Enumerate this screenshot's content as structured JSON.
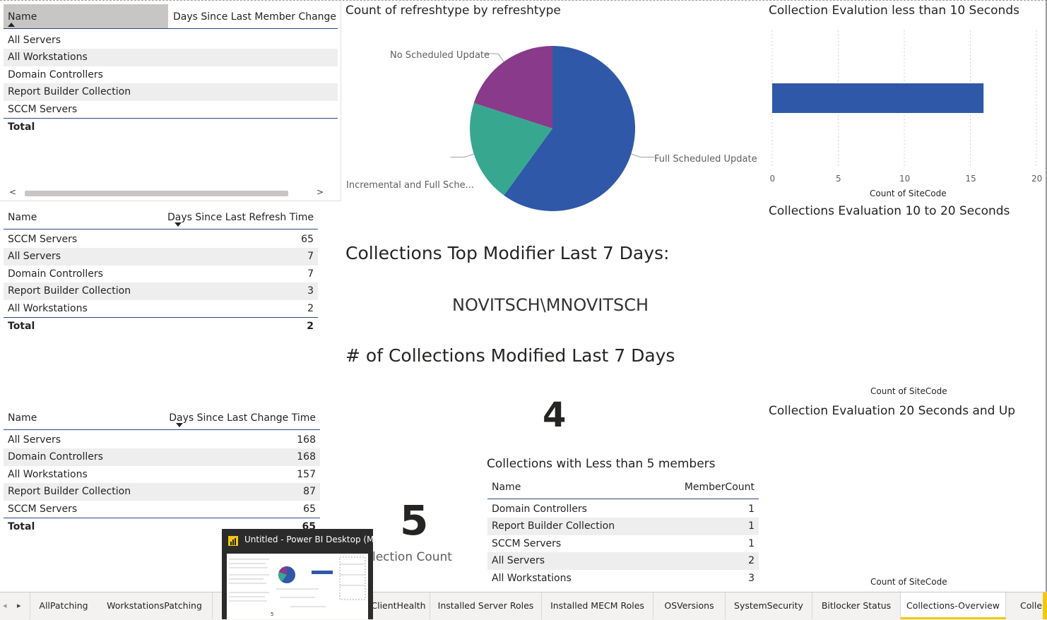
{
  "table1": {
    "col1": "Name",
    "col2": "Days Since Last Member Change T",
    "rows": [
      "All Servers",
      "All Workstations",
      "Domain Controllers",
      "Report Builder Collection",
      "SCCM Servers"
    ],
    "total_label": "Total",
    "scroll_left": "<",
    "scroll_right": ">"
  },
  "table2": {
    "col1": "Name",
    "col2": "Days Since Last Refresh Time",
    "rows": [
      {
        "name": "SCCM Servers",
        "value": "65"
      },
      {
        "name": "All Servers",
        "value": "7"
      },
      {
        "name": "Domain Controllers",
        "value": "7"
      },
      {
        "name": "Report Builder Collection",
        "value": "3"
      },
      {
        "name": "All Workstations",
        "value": "2"
      }
    ],
    "total_label": "Total",
    "total_value": "2"
  },
  "table3": {
    "col1": "Name",
    "col2": "Days Since Last Change Time",
    "rows": [
      {
        "name": "All Servers",
        "value": "168"
      },
      {
        "name": "Domain Controllers",
        "value": "168"
      },
      {
        "name": "All Workstations",
        "value": "157"
      },
      {
        "name": "Report Builder Collection",
        "value": "87"
      },
      {
        "name": "SCCM Servers",
        "value": "65"
      }
    ],
    "total_label": "Total",
    "total_value": "65"
  },
  "pie": {
    "title": "Count of refreshtype by refreshtype"
  },
  "chart_data": [
    {
      "type": "pie",
      "title": "Count of refreshtype by refreshtype",
      "categories": [
        "Full Scheduled Update",
        "Incremental and Full Sche...",
        "No Scheduled Update"
      ],
      "values": [
        3,
        1,
        1
      ],
      "colors": [
        "#2f58a8",
        "#37a88f",
        "#8a3a8a"
      ]
    },
    {
      "type": "bar",
      "title": "Collection Evalution less than 10 Seconds",
      "categories": [
        ""
      ],
      "values": [
        16
      ],
      "xlabel": "Count of SiteCode",
      "xlim": [
        0,
        20
      ],
      "ticks": [
        "0",
        "5",
        "10",
        "15",
        "20"
      ],
      "color": "#2f58a8"
    }
  ],
  "bar": {
    "title": "Collection Evalution less than 10 Seconds",
    "xlabel": "Count of SiteCode",
    "ticks": [
      "0",
      "5",
      "10",
      "15",
      "20"
    ]
  },
  "eval1020": {
    "title": "Collections Evaluation 10 to 20 Seconds",
    "xlabel": "Count of SiteCode"
  },
  "eval20": {
    "title": "Collection Evaluation 20 Seconds and Up",
    "xlabel": "Count of SiteCode"
  },
  "modifier": {
    "title": "Collections Top Modifier Last 7 Days:",
    "value": "NOVITSCH\\MNOVITSCH"
  },
  "modified": {
    "title": "# of Collections Modified Last 7 Days",
    "value": "4"
  },
  "collcount": {
    "value": "5",
    "label": "Collection Count"
  },
  "less5": {
    "title": "Collections with Less than 5 members",
    "col1": "Name",
    "col2": "MemberCount",
    "rows": [
      {
        "name": "Domain Controllers",
        "value": "1"
      },
      {
        "name": "Report Builder Collection",
        "value": "1"
      },
      {
        "name": "SCCM Servers",
        "value": "1"
      },
      {
        "name": "All Servers",
        "value": "2"
      },
      {
        "name": "All Workstations",
        "value": "3"
      }
    ]
  },
  "tabs": {
    "prev": "◂",
    "next": "▸",
    "items": [
      "AllPatching",
      "WorkstationsPatching",
      "ClientHealth",
      "Installed Server Roles",
      "Installed MECM Roles",
      "OSVersions",
      "SystemSecurity",
      "Bitlocker Status",
      "Collections-Overview",
      "Colle"
    ],
    "active": "Collections-Overview"
  },
  "taskbar_preview": {
    "title": "Untitled - Power BI Desktop (M..."
  }
}
